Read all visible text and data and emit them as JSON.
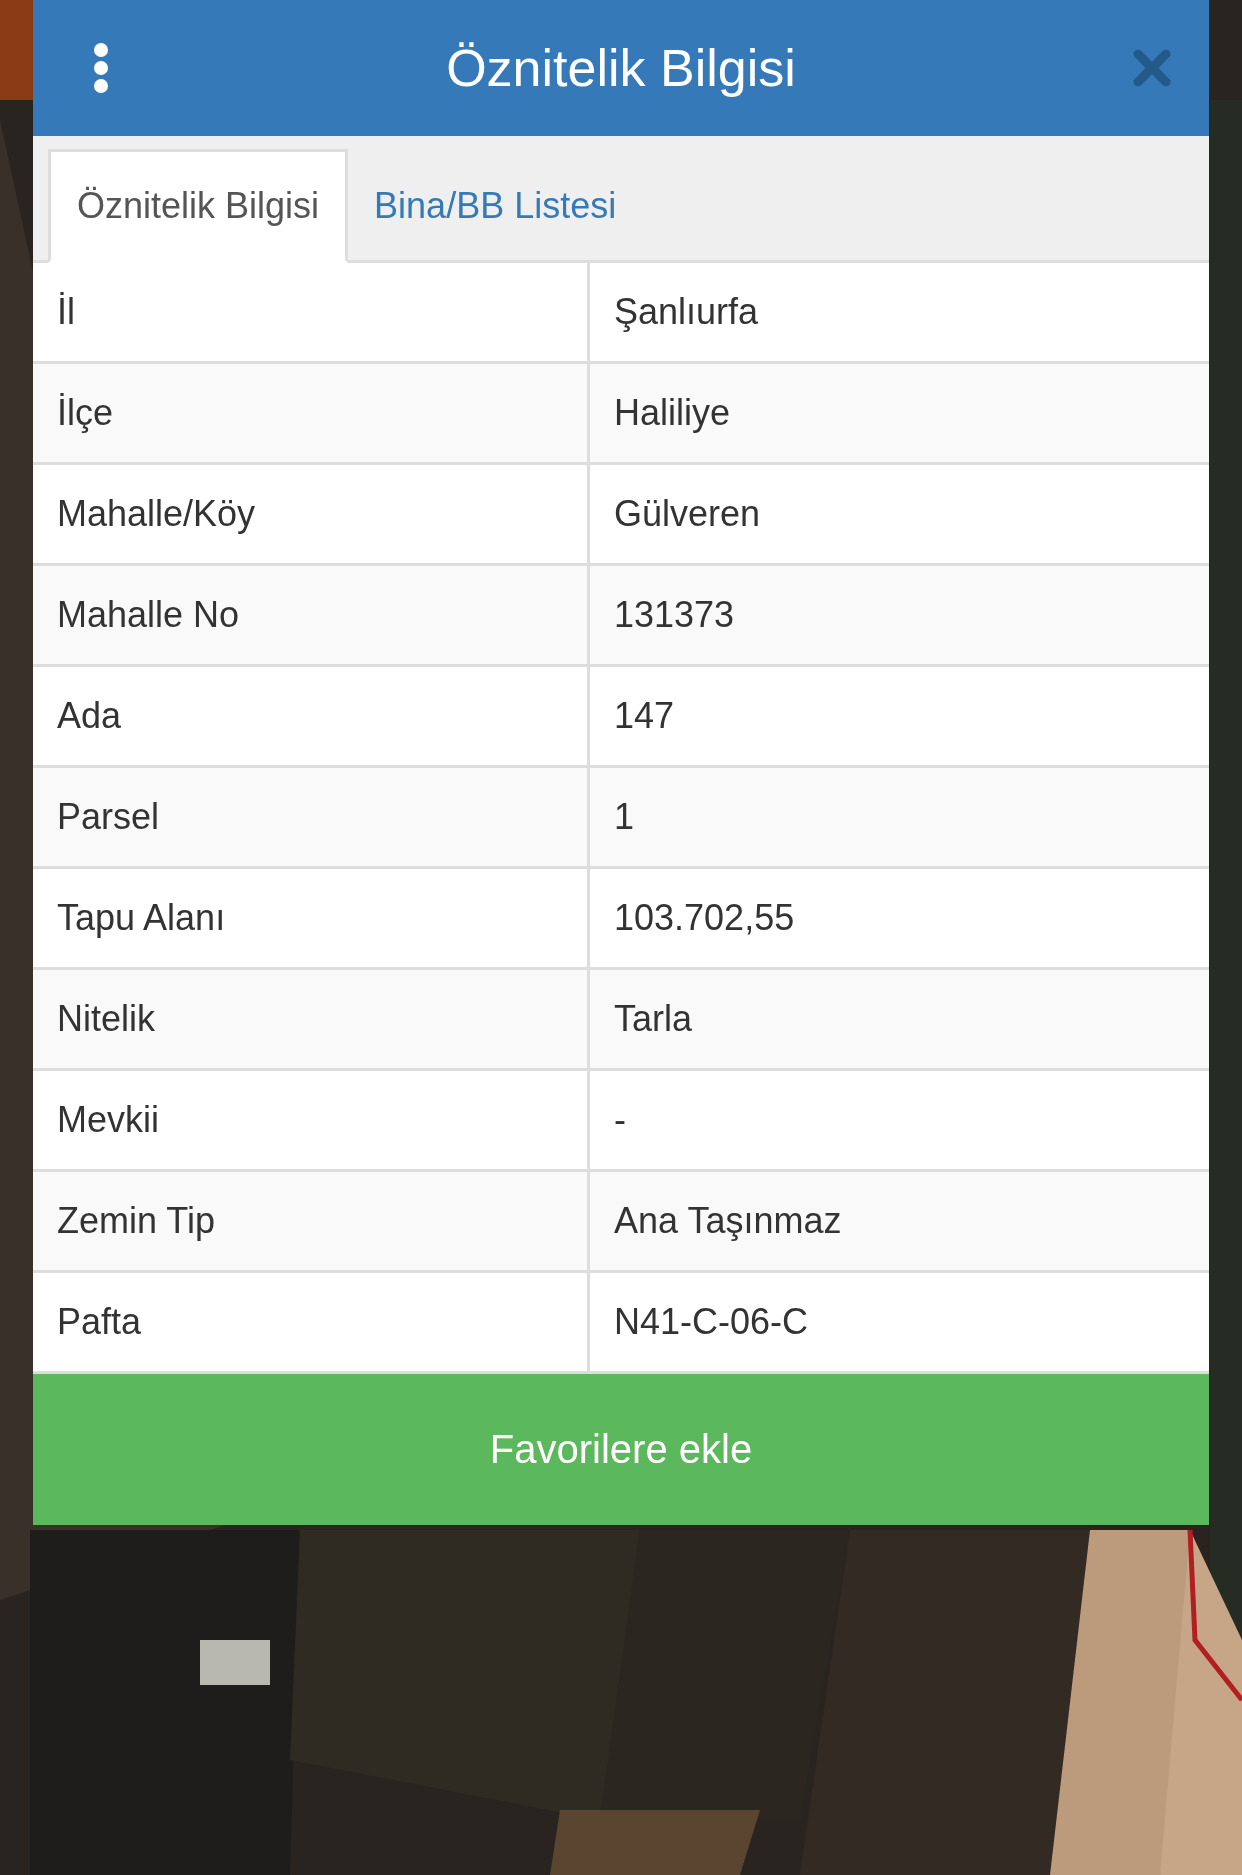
{
  "dialog": {
    "title": "Öznitelik Bilgisi",
    "tabs": [
      {
        "label": "Öznitelik Bilgisi",
        "selected": true
      },
      {
        "label": "Bina/BB Listesi",
        "selected": false
      }
    ],
    "rows": [
      {
        "label": "İl",
        "value": "Şanlıurfa"
      },
      {
        "label": "İlçe",
        "value": "Haliliye"
      },
      {
        "label": "Mahalle/Köy",
        "value": "Gülveren"
      },
      {
        "label": "Mahalle No",
        "value": "131373"
      },
      {
        "label": "Ada",
        "value": "147"
      },
      {
        "label": "Parsel",
        "value": "1"
      },
      {
        "label": "Tapu Alanı",
        "value": "103.702,55"
      },
      {
        "label": "Nitelik",
        "value": "Tarla"
      },
      {
        "label": "Mevkii",
        "value": "-"
      },
      {
        "label": "Zemin Tip",
        "value": "Ana Taşınmaz"
      },
      {
        "label": "Pafta",
        "value": "N41-C-06-C"
      }
    ],
    "button": "Favorilere ekle"
  }
}
